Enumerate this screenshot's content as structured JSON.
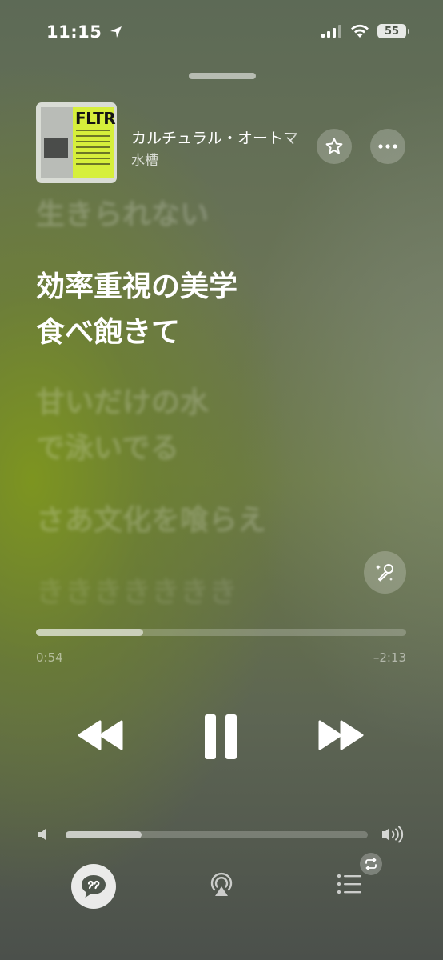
{
  "status_bar": {
    "time": "11:15",
    "battery": "55",
    "icons": [
      "location-arrow-icon",
      "cellular-signal-icon",
      "wifi-icon",
      "battery-icon"
    ]
  },
  "now_playing": {
    "artwork_text": "FLTR",
    "title": "カルチュラル・オートマ",
    "artist": "水槽"
  },
  "lyrics": {
    "previous": "生きられない",
    "active_line_1": "効率重視の美学",
    "active_line_2": "食べ飽きて",
    "next_1": "甘いだけの水",
    "next_2": "で泳いでる",
    "next_3": "さあ文化を喰らえ",
    "next_4": "ききききききき"
  },
  "playback": {
    "elapsed": "0:54",
    "remaining": "–2:13",
    "progress": 0.29
  },
  "volume": {
    "level": 0.25
  },
  "colors": {
    "accent": "#d6ef3b",
    "background_green": "#7e961e",
    "background_gray": "#5d6a56"
  }
}
